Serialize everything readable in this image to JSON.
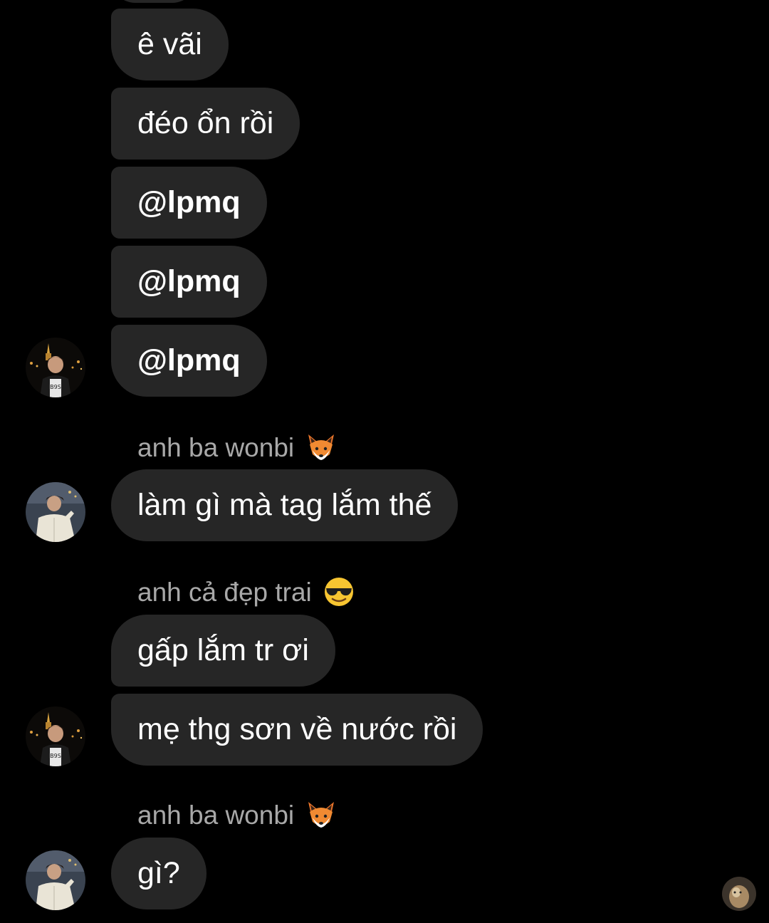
{
  "messages": [
    {
      "text": "ê vãi"
    },
    {
      "text": "đéo ổn rồi"
    },
    {
      "text": "@lpmq"
    },
    {
      "text": "@lpmq"
    },
    {
      "text": "@lpmq"
    },
    {
      "text": "làm gì mà tag lắm thế"
    },
    {
      "text": "gấp lắm tr ơi"
    },
    {
      "text": "mẹ thg sơn về nước rồi"
    },
    {
      "text": "gì?"
    }
  ],
  "senders": {
    "wonbi_1": "anh ba wonbi",
    "dep_trai": "anh cả đẹp trai",
    "wonbi_2": "anh ba wonbi"
  },
  "icons": {
    "fox": "fox-emoji",
    "sunglasses": "smiling-face-with-sunglasses-emoji"
  },
  "colors": {
    "background": "#000000",
    "bubble": "#262626",
    "sender_text": "#a8a8a8",
    "message_text": "#ffffff"
  }
}
